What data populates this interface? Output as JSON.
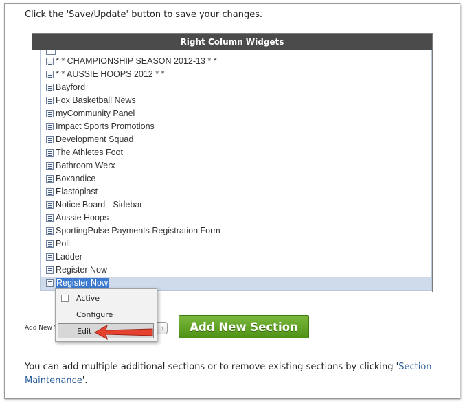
{
  "instructions": {
    "top": "Click the 'Save/Update' button to save your changes."
  },
  "panel": {
    "title": "Right Column Widgets",
    "items": [
      "* * CHAMPIONSHIP SEASON 2012-13 * *",
      "* * AUSSIE HOOPS 2012 * *",
      "Bayford",
      "Fox Basketball News",
      "myCommunity Panel",
      "Impact Sports Promotions",
      "Development Squad",
      "The Athletes Foot",
      "Bathroom Werx",
      "Boxandice",
      "Elastoplast",
      "Notice Board - Sidebar",
      "Aussie Hoops",
      "SportingPulse Payments Registration Form",
      "Poll",
      "Ladder",
      "Register Now",
      "Register Now"
    ],
    "selected_index": 17
  },
  "context_menu": {
    "active_label": "Active",
    "configure_label": "Configure",
    "edit_label": "Edit"
  },
  "add_section": {
    "label": "Add New W",
    "select_caret": "↕",
    "button_label": "Add New Section"
  },
  "bottom": {
    "text_before": "You can add multiple additional sections or to remove existing sections by clicking '",
    "link_text": "Section Maintenance",
    "text_after": "'."
  },
  "colors": {
    "header_bg": "#4b4b4b",
    "selection": "#3d7bd0",
    "button_green": "#5a9e1f",
    "arrow_red": "#e4422f",
    "link": "#2a5d9a"
  }
}
